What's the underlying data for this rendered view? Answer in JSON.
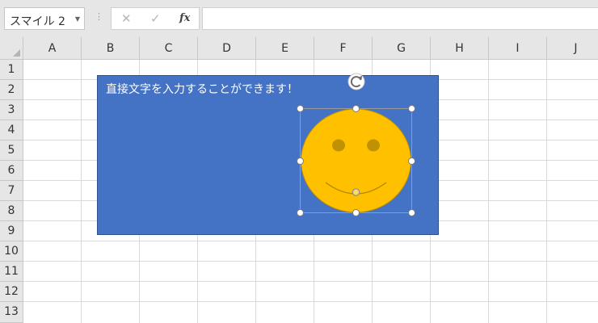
{
  "namebox": {
    "value": "スマイル 2",
    "dropdown_icon": "chevron-down-icon"
  },
  "formula_bar": {
    "separator": "⋮",
    "cancel_icon": "✕",
    "enter_icon": "✓",
    "fx_label": "fx",
    "value": ""
  },
  "columns": [
    "A",
    "B",
    "C",
    "D",
    "E",
    "F",
    "G",
    "H",
    "I",
    "J"
  ],
  "rows": [
    "1",
    "2",
    "3",
    "4",
    "5",
    "6",
    "7",
    "8",
    "9",
    "10",
    "11",
    "13"
  ],
  "shape": {
    "text": "直接文字を入力することができます！",
    "fill_color": "#4472c4"
  },
  "smiley": {
    "fill_color": "#ffc000",
    "outline_color": "#bf9000",
    "eye_color": "#c09100"
  },
  "colors": {
    "header_bg": "#e6e6e6",
    "grid_line": "#dadada",
    "selection_frame": "#9b9b9b"
  }
}
